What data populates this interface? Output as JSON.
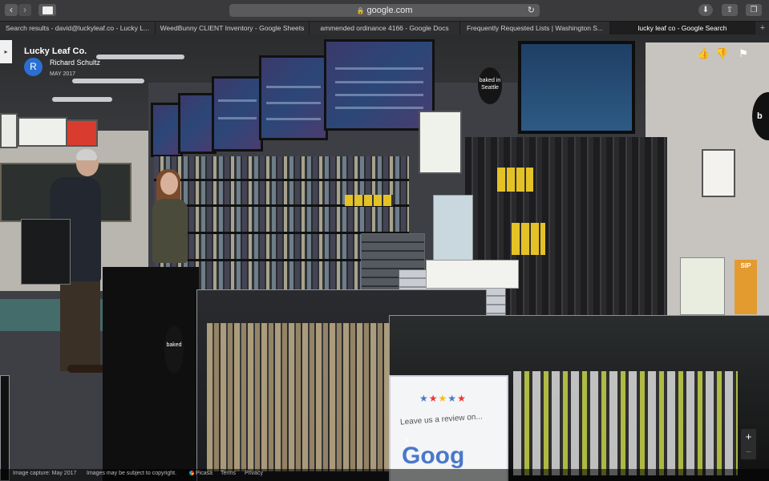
{
  "browser": {
    "url": "google.com",
    "tabs": [
      {
        "label": "Search results - david@luckyleaf.co - Lucky L...",
        "active": false
      },
      {
        "label": "WeedBunny CLIENT Inventory - Google Sheets",
        "active": false
      },
      {
        "label": "ammended ordinance 4166 - Google Docs",
        "active": false
      },
      {
        "label": "Frequently Requested Lists | Washington S...",
        "active": false
      },
      {
        "label": "lucky leaf co - Google Search",
        "active": true
      }
    ],
    "new_tab": "+"
  },
  "photo": {
    "place": "Lucky Leaf Co.",
    "author_initial": "R",
    "author": "Richard Schultz",
    "date": "MAY 2017",
    "accent": "#2c6fd2"
  },
  "store": {
    "brand_circle": "baked in Seattle",
    "brand_circle_right": "b\nin",
    "review_sign_line": "Leave us a review on...",
    "review_sign_brand": "Goog",
    "sip_label": "SIP"
  },
  "controls": {
    "zoom_in": "+",
    "zoom_out": "−",
    "next": "›",
    "expand": "▸"
  },
  "footer": {
    "capture": "Image capture: May 2017",
    "copyright": "Images may be subject to copyright.",
    "picasa": "Picasa",
    "terms": "Terms",
    "privacy": "Privacy"
  }
}
